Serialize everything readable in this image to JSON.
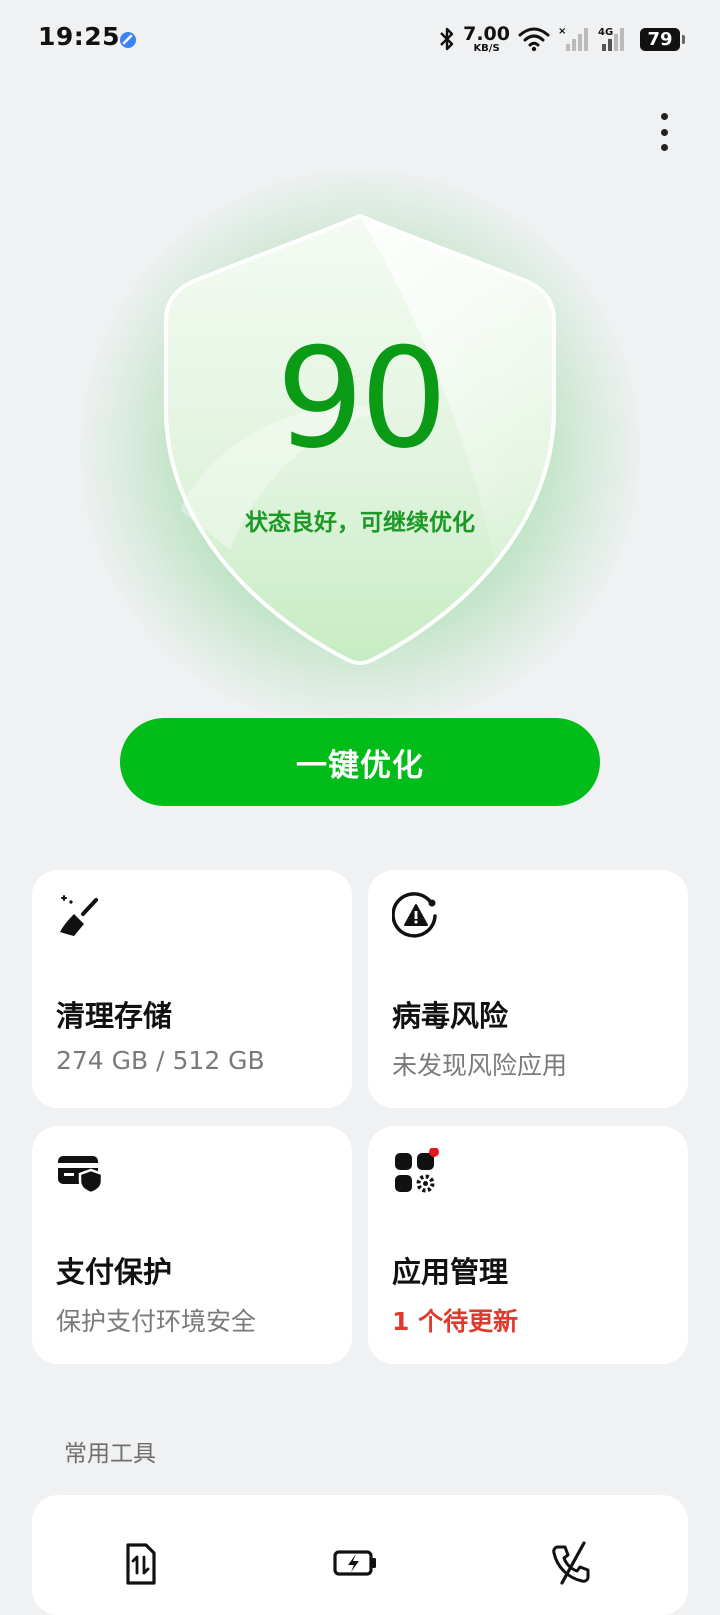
{
  "status_bar": {
    "time": "19:25",
    "net_speed_value": "7.00",
    "net_speed_unit": "KB/S",
    "network_type": "4G",
    "battery": "79"
  },
  "score": {
    "value": "90",
    "caption": "状态良好，可继续优化"
  },
  "optimize_button": {
    "label": "一键优化"
  },
  "cards": [
    {
      "title": "清理存储",
      "subtitle": "274 GB / 512 GB",
      "icon": "broom-icon"
    },
    {
      "title": "病毒风险",
      "subtitle": "未发现风险应用",
      "icon": "virus-warning-icon"
    },
    {
      "title": "支付保护",
      "subtitle": "保护支付环境安全",
      "icon": "payment-shield-icon"
    },
    {
      "title": "应用管理",
      "subtitle": "1 个待更新",
      "icon": "app-manage-icon"
    }
  ],
  "tools_section": {
    "label": "常用工具",
    "items": [
      {
        "icon": "sim-data-icon"
      },
      {
        "icon": "battery-charge-icon"
      },
      {
        "icon": "call-block-icon"
      }
    ]
  },
  "colors": {
    "accent_green": "#02bc1a",
    "score_green": "#0a9a16",
    "alert_red": "#e03a2c",
    "background": "#eff1f2"
  }
}
